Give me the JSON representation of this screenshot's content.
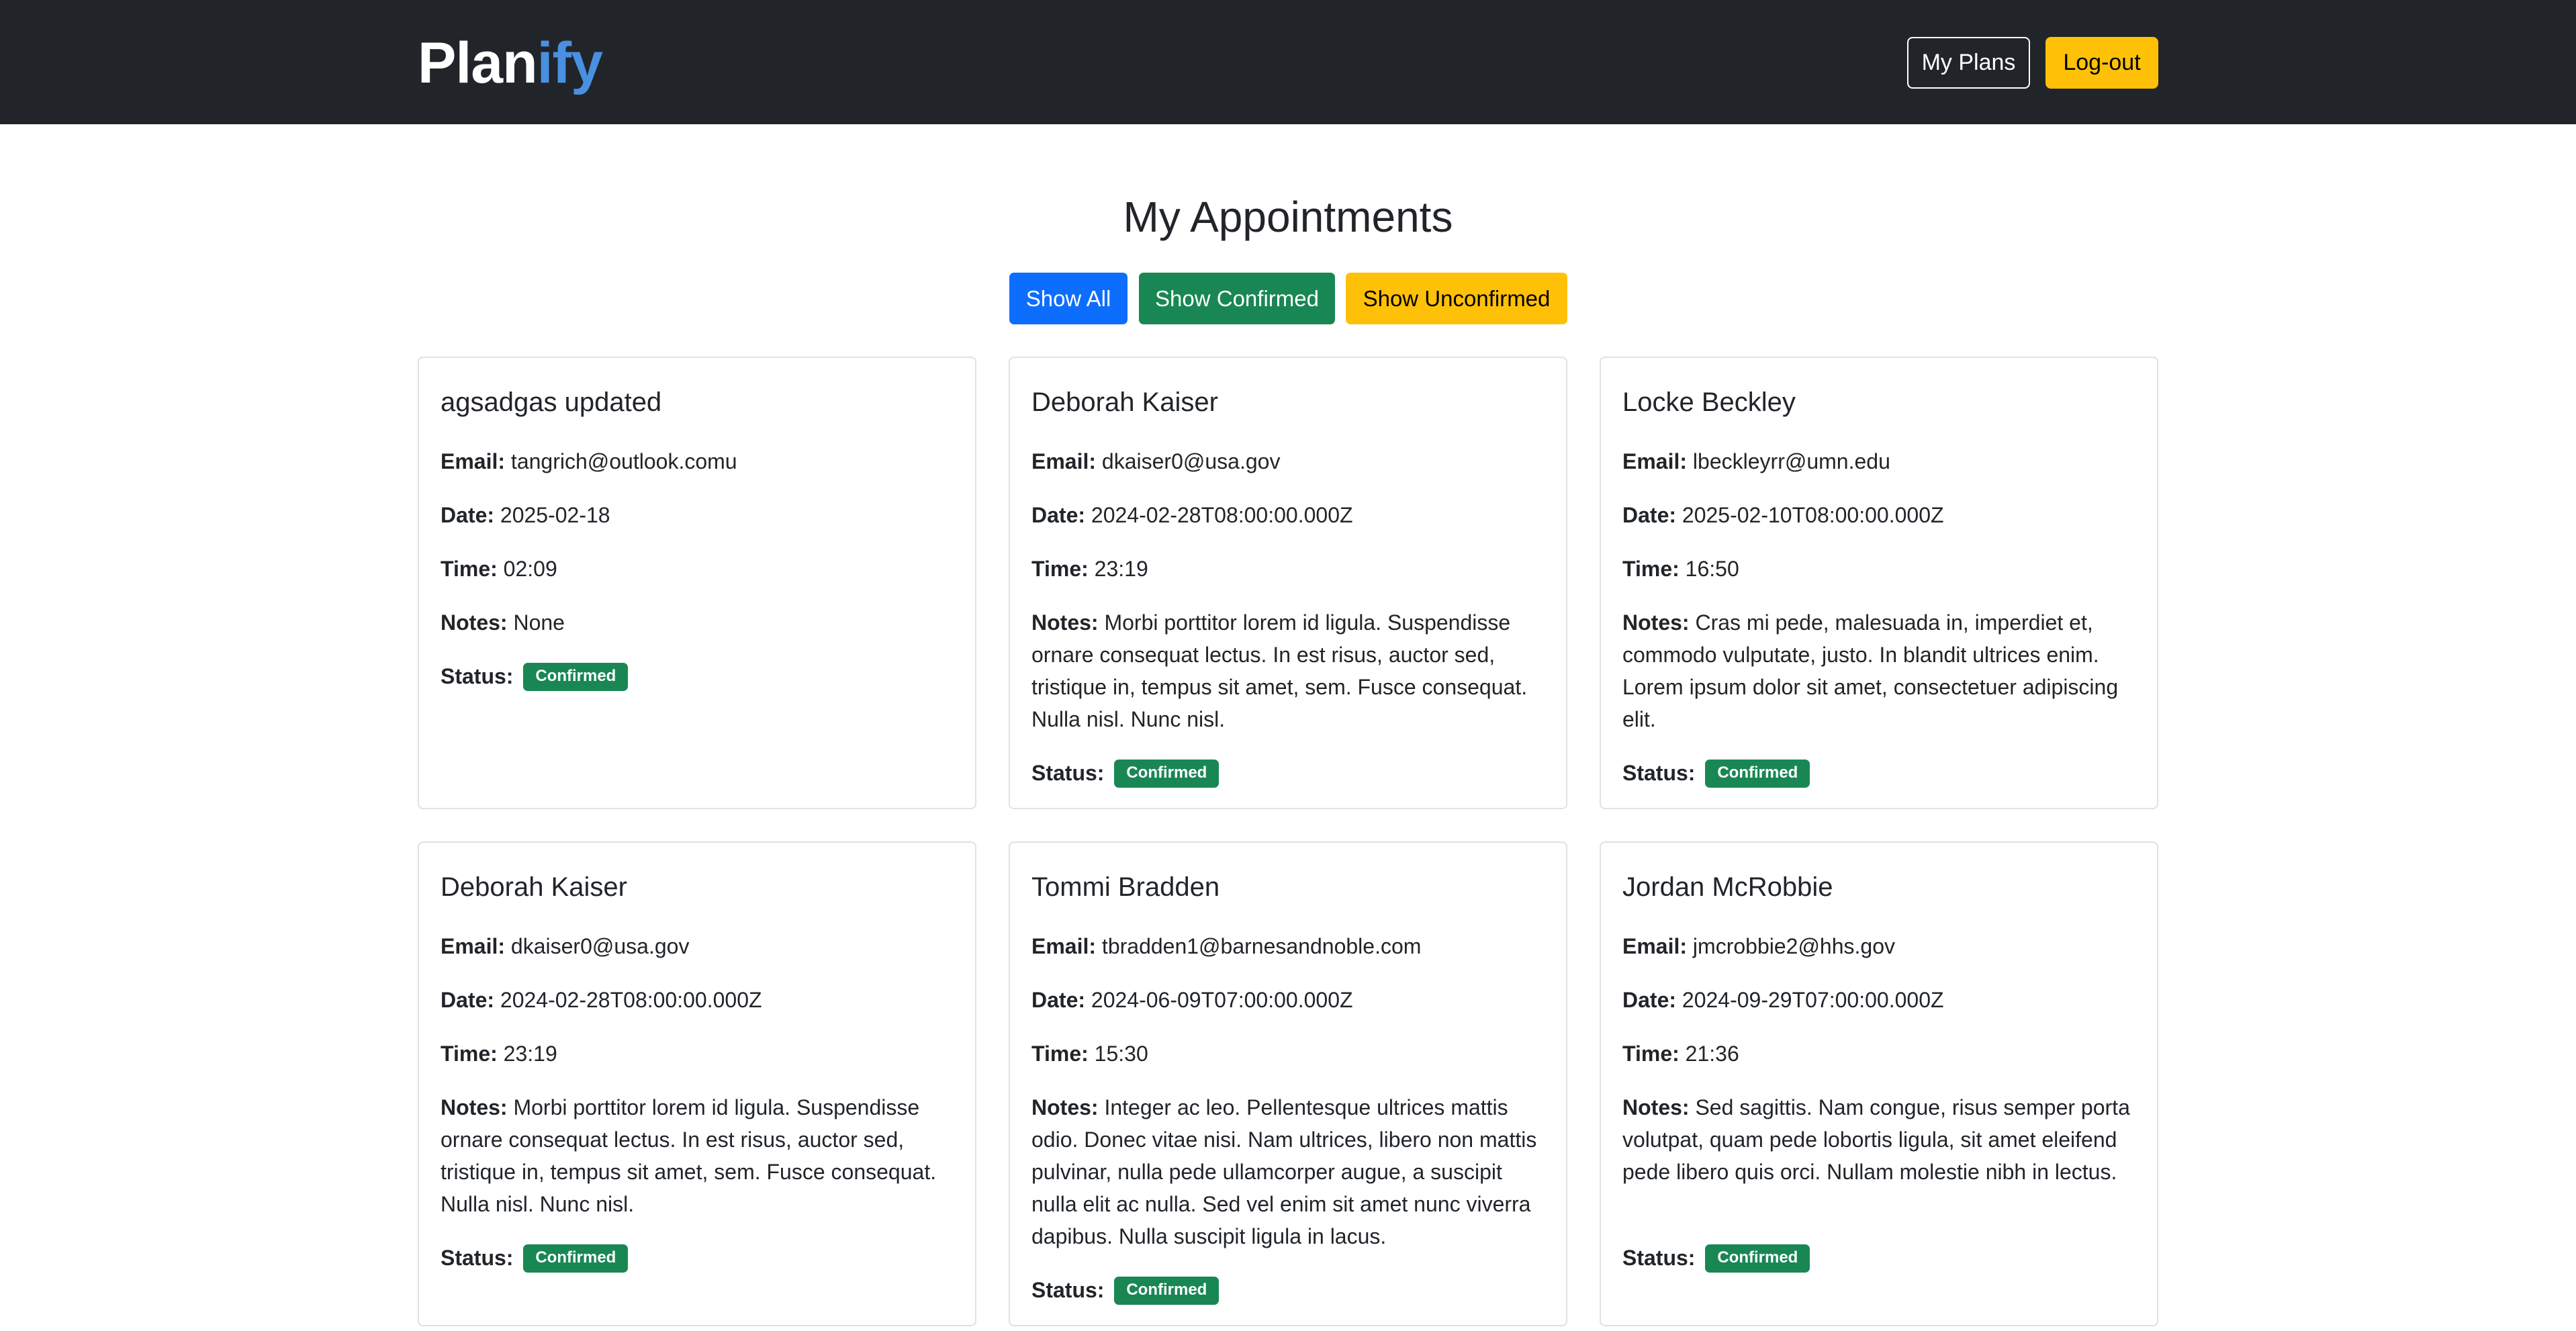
{
  "nav": {
    "brand_main": "Plan",
    "brand_accent": "ify",
    "my_plans": "My Plans",
    "logout": "Log-out"
  },
  "page": {
    "title": "My Appointments"
  },
  "filters": {
    "all": "Show All",
    "confirmed": "Show Confirmed",
    "unconfirmed": "Show Unconfirmed"
  },
  "labels": {
    "email": "Email:",
    "date": "Date:",
    "time": "Time:",
    "notes": "Notes:",
    "status": "Status:"
  },
  "colors": {
    "navbar": "#212529",
    "brand_accent": "#4a90e2",
    "primary": "#0d6efd",
    "success": "#198754",
    "warning": "#ffc107"
  },
  "cards": [
    {
      "name": "agsadgas updated",
      "email": "tangrich@outlook.comu",
      "date": "2025-02-18",
      "time": "02:09",
      "notes": "None",
      "status": "Confirmed"
    },
    {
      "name": "Deborah Kaiser",
      "email": "dkaiser0@usa.gov",
      "date": "2024-02-28T08:00:00.000Z",
      "time": "23:19",
      "notes": "Morbi porttitor lorem id ligula. Suspendisse ornare consequat lectus. In est risus, auctor sed, tristique in, tempus sit amet, sem. Fusce consequat. Nulla nisl. Nunc nisl.",
      "status": "Confirmed"
    },
    {
      "name": "Locke Beckley",
      "email": "lbeckleyrr@umn.edu",
      "date": "2025-02-10T08:00:00.000Z",
      "time": "16:50",
      "notes": "Cras mi pede, malesuada in, imperdiet et, commodo vulputate, justo. In blandit ultrices enim. Lorem ipsum dolor sit amet, consectetuer adipiscing elit.",
      "status": "Confirmed"
    },
    {
      "name": "Deborah Kaiser",
      "email": "dkaiser0@usa.gov",
      "date": "2024-02-28T08:00:00.000Z",
      "time": "23:19",
      "notes": "Morbi porttitor lorem id ligula. Suspendisse ornare consequat lectus. In est risus, auctor sed, tristique in, tempus sit amet, sem. Fusce consequat. Nulla nisl. Nunc nisl.",
      "status": "Confirmed"
    },
    {
      "name": "Tommi Bradden",
      "email": "tbradden1@barnesandnoble.com",
      "date": "2024-06-09T07:00:00.000Z",
      "time": "15:30",
      "notes": "Integer ac leo. Pellentesque ultrices mattis odio. Donec vitae nisi. Nam ultrices, libero non mattis pulvinar, nulla pede ullamcorper augue, a suscipit nulla elit ac nulla. Sed vel enim sit amet nunc viverra dapibus. Nulla suscipit ligula in lacus.",
      "status": "Confirmed"
    },
    {
      "name": "Jordan McRobbie",
      "email": "jmcrobbie2@hhs.gov",
      "date": "2024-09-29T07:00:00.000Z",
      "time": "21:36",
      "notes": "Sed sagittis. Nam congue, risus semper porta volutpat, quam pede lobortis ligula, sit amet eleifend pede libero quis orci. Nullam molestie nibh in lectus.",
      "status": "Confirmed"
    }
  ]
}
